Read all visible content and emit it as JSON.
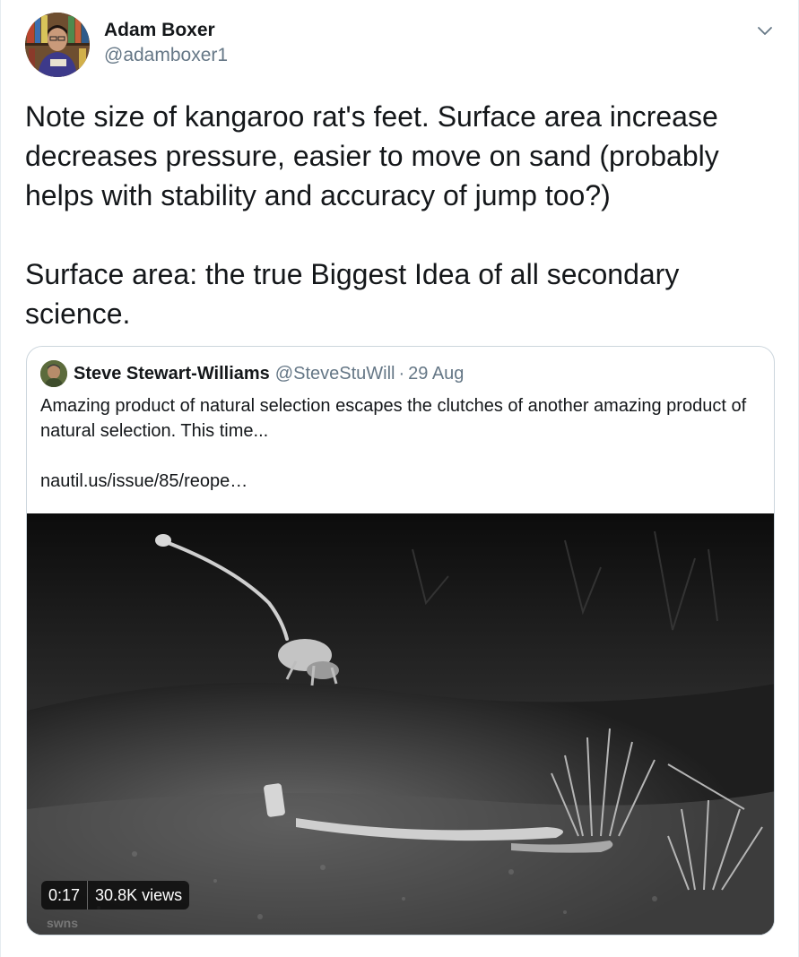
{
  "author": {
    "name": "Adam Boxer",
    "handle": "@adamboxer1"
  },
  "tweet": {
    "text": "Note size of kangaroo rat's feet. Surface area increase decreases pressure, easier to move on sand (probably helps with stability and accuracy of jump too?)\n\nSurface area: the true Biggest Idea of all secondary science."
  },
  "quoted": {
    "name": "Steve Stewart-Williams",
    "handle": "@SteveStuWill",
    "separator": "·",
    "date": "29 Aug",
    "text": "Amazing product of natural selection escapes the clutches of another amazing product of natural selection. This time...",
    "link": "nautil.us/issue/85/reope…"
  },
  "video": {
    "duration": "0:17",
    "views": "30.8K views",
    "watermark": "swns"
  },
  "icons": {
    "menu": "chevron-down-icon"
  },
  "colors": {
    "text": "#14171a",
    "secondary": "#657786",
    "border": "#ccd6dd"
  }
}
